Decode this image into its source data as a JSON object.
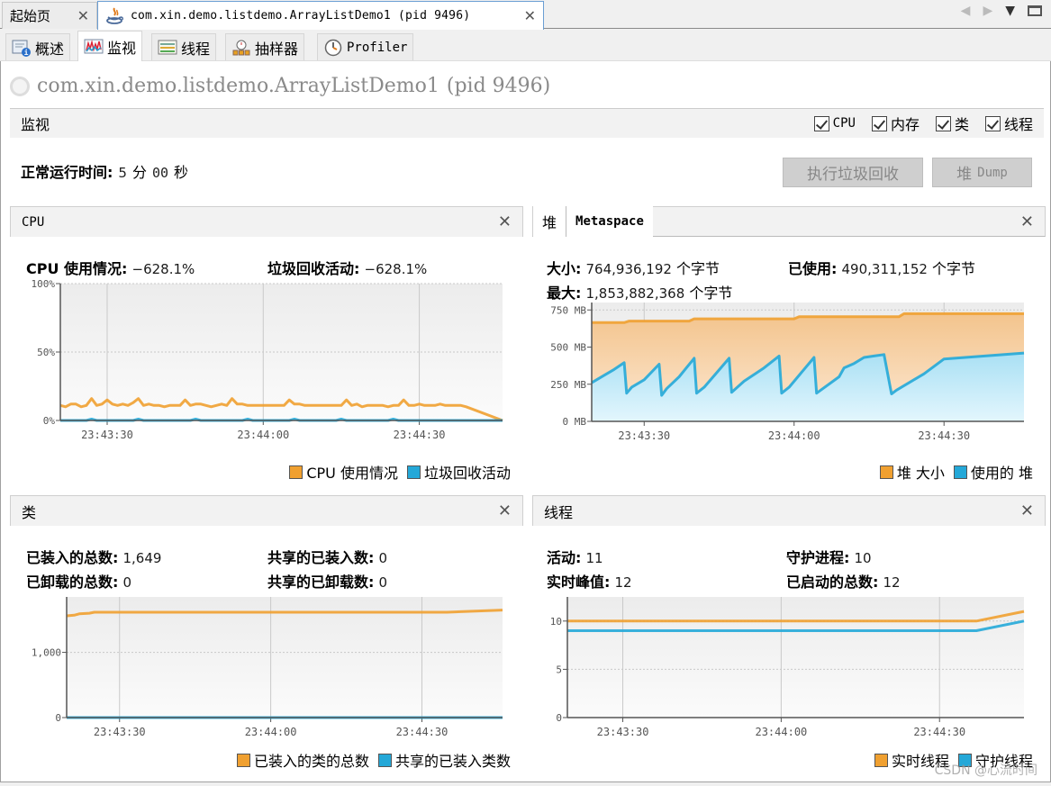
{
  "doc_tabs": [
    {
      "label": "起始页",
      "active": false
    },
    {
      "label": "com.xin.demo.listdemo.ArrayListDemo1 (pid 9496)",
      "active": true
    }
  ],
  "doc_nav": {
    "prev": "◀",
    "next": "▶",
    "menu": "▼"
  },
  "view_tabs": [
    {
      "label": "概述",
      "icon": "overview-icon",
      "active": false
    },
    {
      "label": "监视",
      "icon": "monitor-icon",
      "active": true
    },
    {
      "label": "线程",
      "icon": "threads-icon",
      "active": false
    },
    {
      "label": "抽样器",
      "icon": "sampler-icon",
      "active": false
    },
    {
      "label": "Profiler",
      "icon": "profiler-icon",
      "active": false
    }
  ],
  "app": {
    "name": "com.xin.demo.listdemo.ArrayListDemo1",
    "pid": "(pid 9496)"
  },
  "section": {
    "title": "监视",
    "checkboxes": [
      {
        "label": "CPU",
        "checked": true
      },
      {
        "label": "内存",
        "checked": true
      },
      {
        "label": "类",
        "checked": true
      },
      {
        "label": "线程",
        "checked": true
      }
    ]
  },
  "uptime": {
    "label": "正常运行时间:",
    "minutes": "5",
    "min_unit": "分",
    "seconds": "00",
    "sec_unit": "秒"
  },
  "buttons": {
    "gc": "执行垃圾回收",
    "dump_prefix": "堆",
    "dump_suffix": "Dump"
  },
  "colors": {
    "orange": "#f0a030",
    "blue": "#24a8d8",
    "orange_fill": "#f5c995",
    "blue_fill": "#bfe9f7"
  },
  "cpu_panel": {
    "title": "CPU",
    "stats": [
      {
        "label": "CPU 使用情况:",
        "value": "−628.1%"
      },
      {
        "label": "垃圾回收活动:",
        "value": "−628.1%"
      }
    ],
    "legend": [
      "CPU 使用情况",
      "垃圾回收活动"
    ]
  },
  "heap_panel": {
    "tabs": [
      "堆",
      "Metaspace"
    ],
    "stats": [
      {
        "label": "大小:",
        "value": "764,936,192",
        "unit": "个字节"
      },
      {
        "label": "已使用:",
        "value": "490,311,152",
        "unit": "个字节"
      },
      {
        "label": "最大:",
        "value": "1,853,882,368",
        "unit": "个字节"
      }
    ],
    "legend": [
      "堆 大小",
      "使用的 堆"
    ]
  },
  "classes_panel": {
    "title": "类",
    "stats": [
      {
        "label": "已装入的总数:",
        "value": "1,649"
      },
      {
        "label": "共享的已装入数:",
        "value": "0"
      },
      {
        "label": "已卸载的总数:",
        "value": "0"
      },
      {
        "label": "共享的已卸载数:",
        "value": "0"
      }
    ],
    "legend": [
      "已装入的类的总数",
      "共享的已装入类数"
    ]
  },
  "threads_panel": {
    "title": "线程",
    "stats": [
      {
        "label": "活动:",
        "value": "11"
      },
      {
        "label": "守护进程:",
        "value": "10"
      },
      {
        "label": "实时峰值:",
        "value": "12"
      },
      {
        "label": "已启动的总数:",
        "value": "12"
      }
    ],
    "legend": [
      "实时线程",
      "守护线程"
    ]
  },
  "watermark": "CSDN @心流时间",
  "chart_data": [
    {
      "id": "cpu",
      "type": "line",
      "title": "CPU",
      "x_ticks": [
        "23:43:30",
        "23:44:00",
        "23:44:30"
      ],
      "x_tick_seconds": [
        30,
        60,
        90
      ],
      "xlim": [
        21,
        106
      ],
      "y_ticks": [
        "0%",
        "50%",
        "100%"
      ],
      "y_tick_values": [
        0,
        50,
        100
      ],
      "ylim": [
        0,
        100
      ],
      "grid": true,
      "legend": "bottom-right",
      "series": [
        {
          "name": "CPU 使用情况",
          "color": "#f0a030",
          "x": [
            21,
            22,
            23,
            24,
            25,
            26,
            27,
            28,
            29,
            30,
            31,
            32,
            33,
            34,
            35,
            36,
            37,
            38,
            39,
            40,
            41,
            42,
            43,
            44,
            45,
            46,
            47,
            48,
            49,
            50,
            51,
            52,
            53,
            54,
            55,
            56,
            57,
            58,
            59,
            60,
            61,
            62,
            63,
            64,
            65,
            66,
            67,
            68,
            69,
            70,
            71,
            72,
            73,
            74,
            75,
            76,
            77,
            78,
            79,
            80,
            81,
            82,
            83,
            84,
            85,
            86,
            87,
            88,
            89,
            90,
            91,
            92,
            93,
            94,
            95,
            96,
            97,
            98,
            99,
            106
          ],
          "y": [
            11,
            10,
            12,
            12,
            10,
            11,
            16,
            11,
            12,
            15,
            12,
            11,
            12,
            11,
            13,
            16,
            11,
            12,
            11,
            11,
            10,
            11,
            11,
            11,
            15,
            11,
            12,
            12,
            11,
            10,
            11,
            12,
            11,
            16,
            12,
            12,
            11,
            11,
            11,
            11,
            11,
            11,
            11,
            11,
            15,
            12,
            12,
            11,
            11,
            11,
            11,
            11,
            11,
            11,
            11,
            15,
            11,
            12,
            10,
            11,
            11,
            11,
            11,
            10,
            11,
            11,
            15,
            11,
            11,
            12,
            11,
            11,
            11,
            12,
            11,
            11,
            11,
            11,
            10,
            0
          ]
        },
        {
          "name": "垃圾回收活动",
          "color": "#24a8d8",
          "x": [
            21,
            26,
            27,
            28,
            35,
            36,
            37,
            46,
            47,
            48,
            56,
            57,
            58,
            65,
            66,
            67,
            74,
            75,
            76,
            84,
            85,
            86,
            106
          ],
          "y": [
            0,
            0,
            1,
            0,
            0,
            1,
            0,
            0,
            1,
            0,
            0,
            1,
            0,
            0,
            1,
            0,
            0,
            1,
            0,
            0,
            1,
            0,
            0
          ]
        }
      ]
    },
    {
      "id": "heap",
      "type": "area",
      "title": "堆",
      "x_ticks": [
        "23:43:30",
        "23:44:00",
        "23:44:30"
      ],
      "x_tick_seconds": [
        30,
        60,
        90
      ],
      "xlim": [
        19.5,
        106
      ],
      "y_ticks": [
        "0 MB",
        "250 MB",
        "500 MB",
        "750 MB"
      ],
      "y_tick_values": [
        0,
        250,
        500,
        750
      ],
      "ylim": [
        0,
        800
      ],
      "grid": true,
      "legend": "bottom-right",
      "series": [
        {
          "name": "堆 大小",
          "color": "#f0a030",
          "x": [
            19.5,
            26,
            27,
            39,
            40,
            60,
            61,
            81,
            82,
            106
          ],
          "y": [
            665,
            665,
            675,
            675,
            690,
            690,
            705,
            705,
            725,
            725
          ]
        },
        {
          "name": "使用的 堆",
          "color": "#24a8d8",
          "x": [
            19.5,
            22,
            24,
            26,
            26.5,
            27.5,
            30,
            33,
            33.5,
            34.5,
            37,
            40,
            40.5,
            42,
            47,
            47.5,
            50,
            54,
            57,
            57.5,
            59,
            64,
            64.5,
            69,
            70,
            72,
            74,
            76,
            78,
            79.5,
            80.5,
            86,
            90,
            106
          ],
          "y": [
            260,
            310,
            350,
            395,
            190,
            230,
            280,
            385,
            175,
            220,
            300,
            425,
            190,
            230,
            425,
            195,
            270,
            360,
            440,
            190,
            230,
            430,
            190,
            300,
            360,
            390,
            430,
            440,
            450,
            185,
            210,
            320,
            420,
            460
          ]
        }
      ]
    },
    {
      "id": "classes",
      "type": "line",
      "title": "类",
      "x_ticks": [
        "23:43:30",
        "23:44:00",
        "23:44:30"
      ],
      "x_tick_seconds": [
        30,
        60,
        90
      ],
      "xlim": [
        19.5,
        106
      ],
      "y_ticks": [
        "0",
        "1,000"
      ],
      "y_tick_values": [
        0,
        1000
      ],
      "ylim": [
        0,
        1850
      ],
      "grid": true,
      "legend": "bottom-right",
      "series": [
        {
          "name": "已装入的类的总数",
          "color": "#f0a030",
          "x": [
            19.5,
            21,
            22,
            24,
            25,
            95,
            106
          ],
          "y": [
            1560,
            1570,
            1590,
            1600,
            1615,
            1615,
            1649
          ]
        },
        {
          "name": "共享的已装入类数",
          "color": "#24a8d8",
          "x": [
            19.5,
            106
          ],
          "y": [
            0,
            0
          ]
        }
      ]
    },
    {
      "id": "threads",
      "type": "line",
      "title": "线程",
      "x_ticks": [
        "23:43:30",
        "23:44:00",
        "23:44:30"
      ],
      "x_tick_seconds": [
        30,
        60,
        90
      ],
      "xlim": [
        19.5,
        106
      ],
      "y_ticks": [
        "0",
        "5",
        "10"
      ],
      "y_tick_values": [
        0,
        5,
        10
      ],
      "ylim": [
        0,
        12.5
      ],
      "grid": true,
      "legend": "bottom-right",
      "series": [
        {
          "name": "实时线程",
          "color": "#f0a030",
          "x": [
            19.5,
            97,
            106
          ],
          "y": [
            10,
            10,
            11
          ]
        },
        {
          "name": "守护线程",
          "color": "#24a8d8",
          "x": [
            19.5,
            97,
            106
          ],
          "y": [
            9,
            9,
            10
          ]
        }
      ]
    }
  ]
}
